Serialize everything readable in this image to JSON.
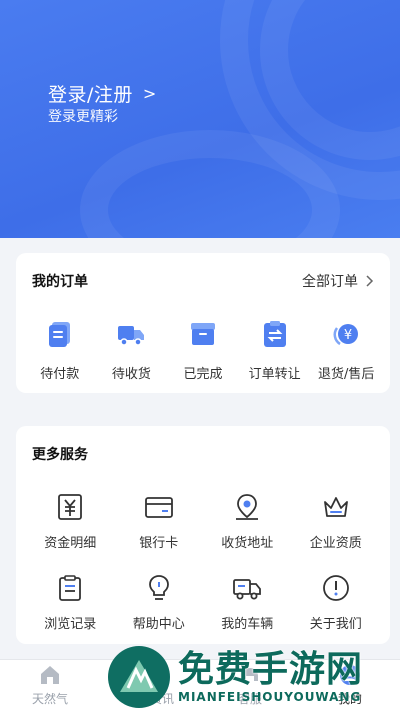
{
  "header": {
    "login_title": "登录/注册",
    "login_chevron": ">",
    "login_subtitle": "登录更精彩"
  },
  "orders": {
    "title": "我的订单",
    "all_link": "全部订单",
    "items": [
      {
        "label": "待付款",
        "icon": "document-icon"
      },
      {
        "label": "待收货",
        "icon": "truck-icon"
      },
      {
        "label": "已完成",
        "icon": "box-icon"
      },
      {
        "label": "订单转让",
        "icon": "transfer-icon"
      },
      {
        "label": "退货/售后",
        "icon": "refund-icon"
      }
    ]
  },
  "services": {
    "title": "更多服务",
    "items": [
      {
        "label": "资金明细",
        "icon": "yuan-icon"
      },
      {
        "label": "银行卡",
        "icon": "card-icon"
      },
      {
        "label": "收货地址",
        "icon": "location-icon"
      },
      {
        "label": "企业资质",
        "icon": "crown-icon"
      },
      {
        "label": "浏览记录",
        "icon": "clipboard-icon"
      },
      {
        "label": "帮助中心",
        "icon": "bulb-icon"
      },
      {
        "label": "我的车辆",
        "icon": "truck-outline-icon"
      },
      {
        "label": "关于我们",
        "icon": "info-icon"
      }
    ]
  },
  "tabbar": {
    "items": [
      {
        "label": "天然气",
        "icon": "home-icon"
      },
      {
        "label": "行情资讯",
        "icon": "chart-icon"
      },
      {
        "label": "客服",
        "icon": "service-icon"
      },
      {
        "label": "我的",
        "icon": "user-icon",
        "active": true
      }
    ]
  },
  "watermark": {
    "text": "免费手游网",
    "sub": "MIANFEISHOUYOUWANG"
  },
  "colors": {
    "primary": "#4a7cf0",
    "icon_blue": "#4f7ff0"
  }
}
